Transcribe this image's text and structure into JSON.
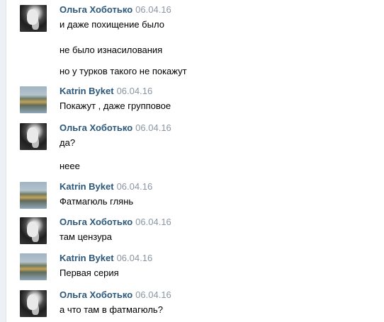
{
  "messages": [
    {
      "author": "Ольга Хоботько",
      "date": "06.04.16",
      "lines": [
        "и даже похищение было",
        "не было изнасилования",
        "но у турков такого не покажут"
      ]
    },
    {
      "author": "Katrin Byket",
      "date": "06.04.16",
      "lines": [
        "Покажут , даже групповое"
      ]
    },
    {
      "author": "Ольга Хоботько",
      "date": "06.04.16",
      "lines": [
        "да?",
        "неее"
      ]
    },
    {
      "author": "Katrin Byket",
      "date": "06.04.16",
      "lines": [
        "Фатмагюль глянь"
      ]
    },
    {
      "author": "Ольга Хоботько",
      "date": "06.04.16",
      "lines": [
        "там цензура"
      ]
    },
    {
      "author": "Katrin Byket",
      "date": "06.04.16",
      "lines": [
        "Первая серия"
      ]
    },
    {
      "author": "Ольга Хоботько",
      "date": "06.04.16",
      "lines": [
        "а что там в фатмагюль?"
      ]
    }
  ]
}
